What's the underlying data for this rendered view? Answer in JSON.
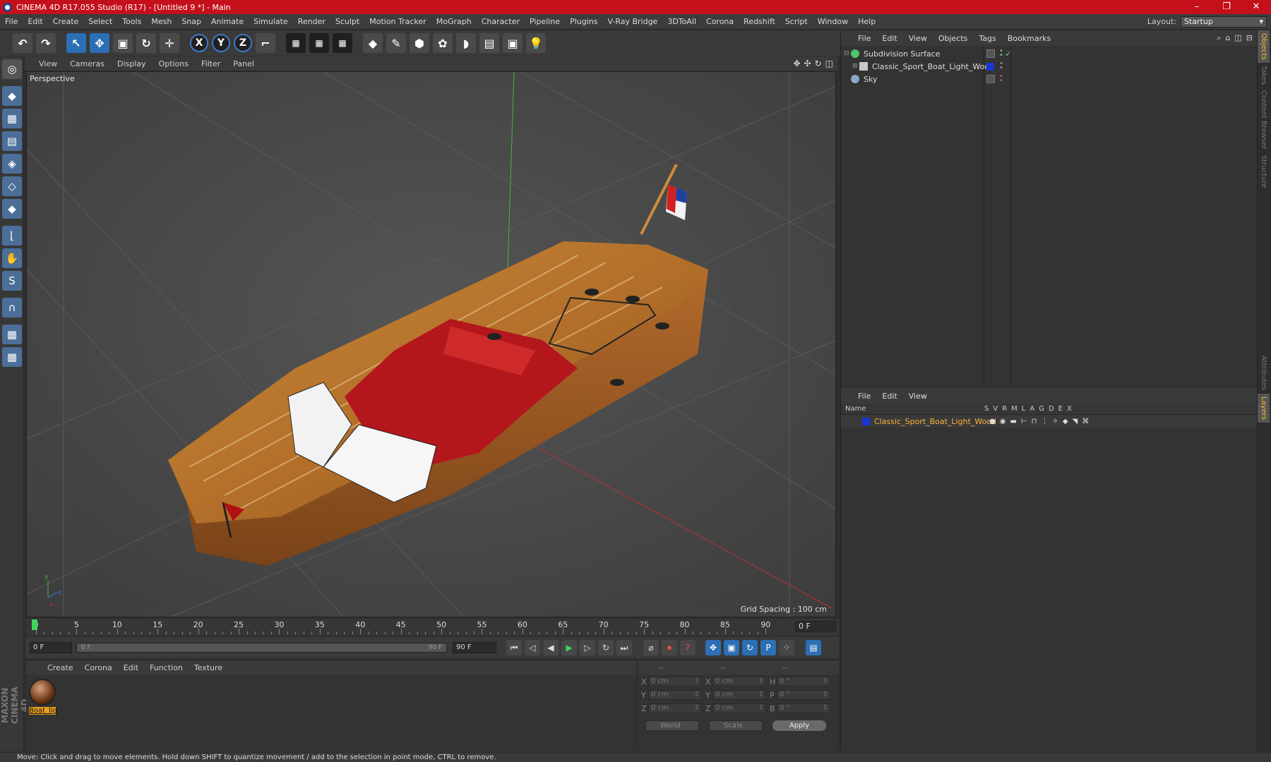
{
  "titlebar": {
    "title": "CINEMA 4D R17.055 Studio (R17) - [Untitled 9 *] - Main",
    "min": "–",
    "max": "❐",
    "close": "✕"
  },
  "menubar": {
    "items": [
      "File",
      "Edit",
      "Create",
      "Select",
      "Tools",
      "Mesh",
      "Snap",
      "Animate",
      "Simulate",
      "Render",
      "Sculpt",
      "Motion Tracker",
      "MoGraph",
      "Character",
      "Pipeline",
      "Plugins",
      "V-Ray Bridge",
      "3DToAll",
      "Corona",
      "Redshift",
      "Script",
      "Window",
      "Help"
    ],
    "layout_label": "Layout:",
    "layout_value": "Startup"
  },
  "toolbar": {
    "undo": "↶",
    "redo": "↷",
    "select": "↖",
    "move": "✥",
    "scale": "▣",
    "rotate": "↻",
    "axis_x": "X",
    "axis_y": "Y",
    "axis_z": "Z"
  },
  "viewport": {
    "menu": [
      "View",
      "Cameras",
      "Display",
      "Options",
      "Filter",
      "Panel"
    ],
    "label": "Perspective",
    "grid_spacing": "Grid Spacing : 100 cm"
  },
  "timeline": {
    "ticks": [
      "0",
      "5",
      "10",
      "15",
      "20",
      "25",
      "30",
      "35",
      "40",
      "45",
      "50",
      "55",
      "60",
      "65",
      "70",
      "75",
      "80",
      "85",
      "90"
    ],
    "current_frame": "0 F",
    "end_field": "0 F"
  },
  "transport": {
    "start": "0 F",
    "slider_left": "0 F",
    "slider_right": "90 F",
    "end": "90 F"
  },
  "materials": {
    "menu": [
      "Create",
      "Corona",
      "Edit",
      "Function",
      "Texture"
    ],
    "items": [
      {
        "label": "Boat_lig"
      }
    ]
  },
  "coords": {
    "head": [
      "--",
      "--",
      "--"
    ],
    "rows": [
      {
        "a": "X",
        "v1": "0 cm",
        "b": "X",
        "v2": "0 cm",
        "c": "H",
        "v3": "0 °"
      },
      {
        "a": "Y",
        "v1": "0 cm",
        "b": "Y",
        "v2": "0 cm",
        "c": "P",
        "v3": "0 °"
      },
      {
        "a": "Z",
        "v1": "0 cm",
        "b": "Z",
        "v2": "0 cm",
        "c": "B",
        "v3": "0 °"
      }
    ],
    "world": "World",
    "scale": "Scale",
    "apply": "Apply"
  },
  "objects": {
    "menu": [
      "File",
      "Edit",
      "View",
      "Objects",
      "Tags",
      "Bookmarks"
    ],
    "items": [
      {
        "name": "Subdivision Surface",
        "color": "#4fc46a"
      },
      {
        "name": "Classic_Sport_Boat_Light_Wood",
        "color": "#c9c9c9"
      },
      {
        "name": "Sky",
        "color": "#8aa8c8"
      }
    ]
  },
  "layers": {
    "menu": [
      "File",
      "Edit",
      "View"
    ],
    "name_header": "Name",
    "columns": [
      "S",
      "V",
      "R",
      "M",
      "L",
      "A",
      "G",
      "D",
      "E",
      "X"
    ],
    "row": "Classic_Sport_Boat_Light_Wood"
  },
  "rightstrip": [
    "Objects",
    "Takes",
    "Content Browser",
    "Structure",
    "Attributes",
    "Layers"
  ],
  "status": "Move: Click and drag to move elements. Hold down SHIFT to quantize movement / add to the selection in point mode, CTRL to remove.",
  "maxon": "MAXON CINEMA 4D"
}
